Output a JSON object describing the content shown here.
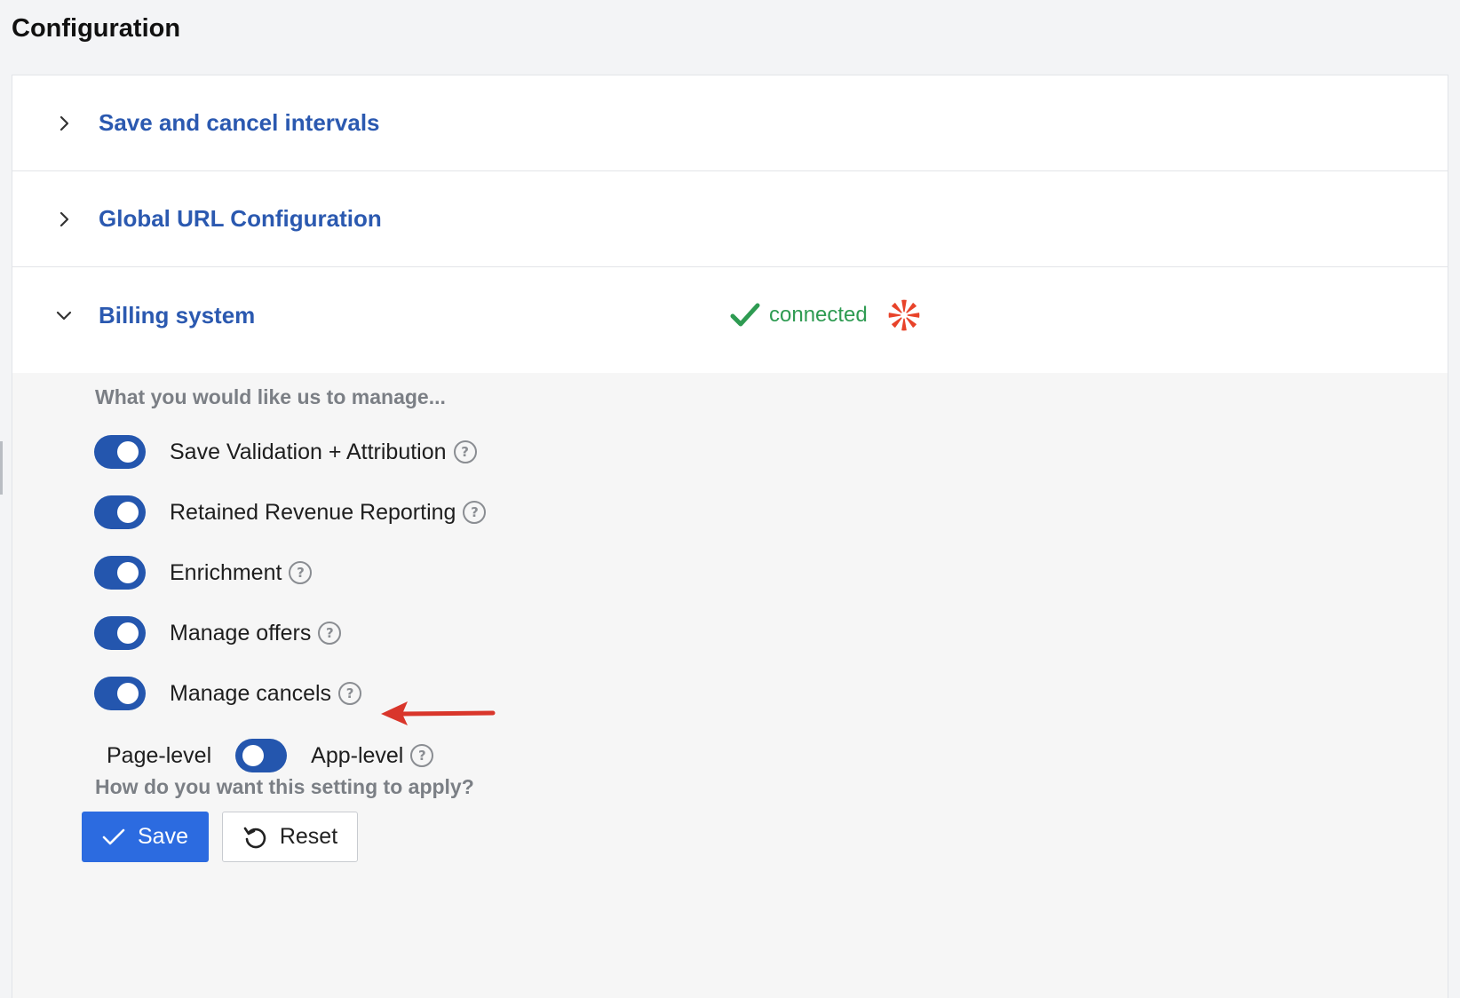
{
  "page": {
    "title": "Configuration"
  },
  "sections": [
    {
      "title": "Save and cancel intervals",
      "expanded": false
    },
    {
      "title": "Global URL Configuration",
      "expanded": false
    },
    {
      "title": "Billing system",
      "expanded": true,
      "status": "connected"
    }
  ],
  "billing": {
    "manage_heading": "What you would like us to manage...",
    "toggles": [
      {
        "label": "Save Validation + Attribution",
        "on": true
      },
      {
        "label": "Retained Revenue Reporting",
        "on": true
      },
      {
        "label": "Enrichment",
        "on": true
      },
      {
        "label": "Manage offers",
        "on": true
      },
      {
        "label": "Manage cancels",
        "on": true
      }
    ],
    "apply_heading": "How do you want this setting to apply?",
    "level": {
      "left_label": "Page-level",
      "right_label": "App-level",
      "selected": "Page-level"
    }
  },
  "buttons": {
    "save": "Save",
    "reset": "Reset"
  },
  "icons": {
    "help": "?"
  },
  "colors": {
    "link_blue": "#2b59b0",
    "toggle_blue": "#2456ae",
    "save_blue": "#2c6be0",
    "connected_green": "#2e9b52",
    "arrow_red": "#d9362b",
    "logo_red": "#e8432a"
  }
}
